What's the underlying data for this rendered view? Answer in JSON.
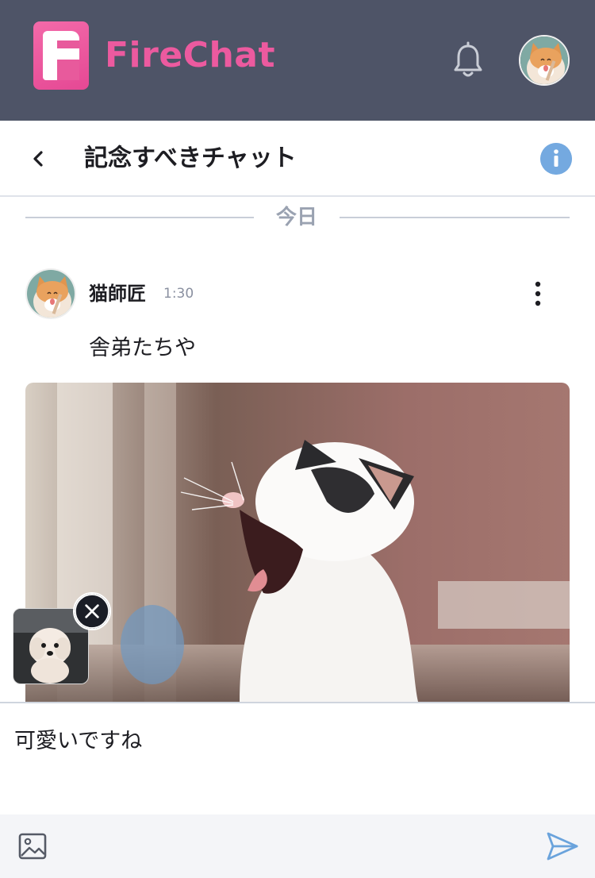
{
  "app": {
    "brand_name": "FireChat",
    "logo_letter": "F",
    "header_color": "#4e5467",
    "brand_color": "#ec5a9f"
  },
  "header": {
    "notification_icon": "bell-icon",
    "avatar_icon": "user-avatar-cat"
  },
  "chat": {
    "title": "記念すべきチャット",
    "back_icon": "chevron-left-icon",
    "info_icon": "info-icon"
  },
  "divider": {
    "label": "今日"
  },
  "message": {
    "author": "猫師匠",
    "time": "1:30",
    "text": "舎弟たちや",
    "image": "yawning-cat-photo",
    "menu_icon": "more-vertical-icon"
  },
  "attachment": {
    "thumbnail": "white-dog-photo",
    "remove_icon": "close-icon"
  },
  "composer": {
    "value": "可愛いですね",
    "image_icon": "image-icon",
    "send_icon": "send-icon",
    "accent_color": "#6aa3dc"
  }
}
